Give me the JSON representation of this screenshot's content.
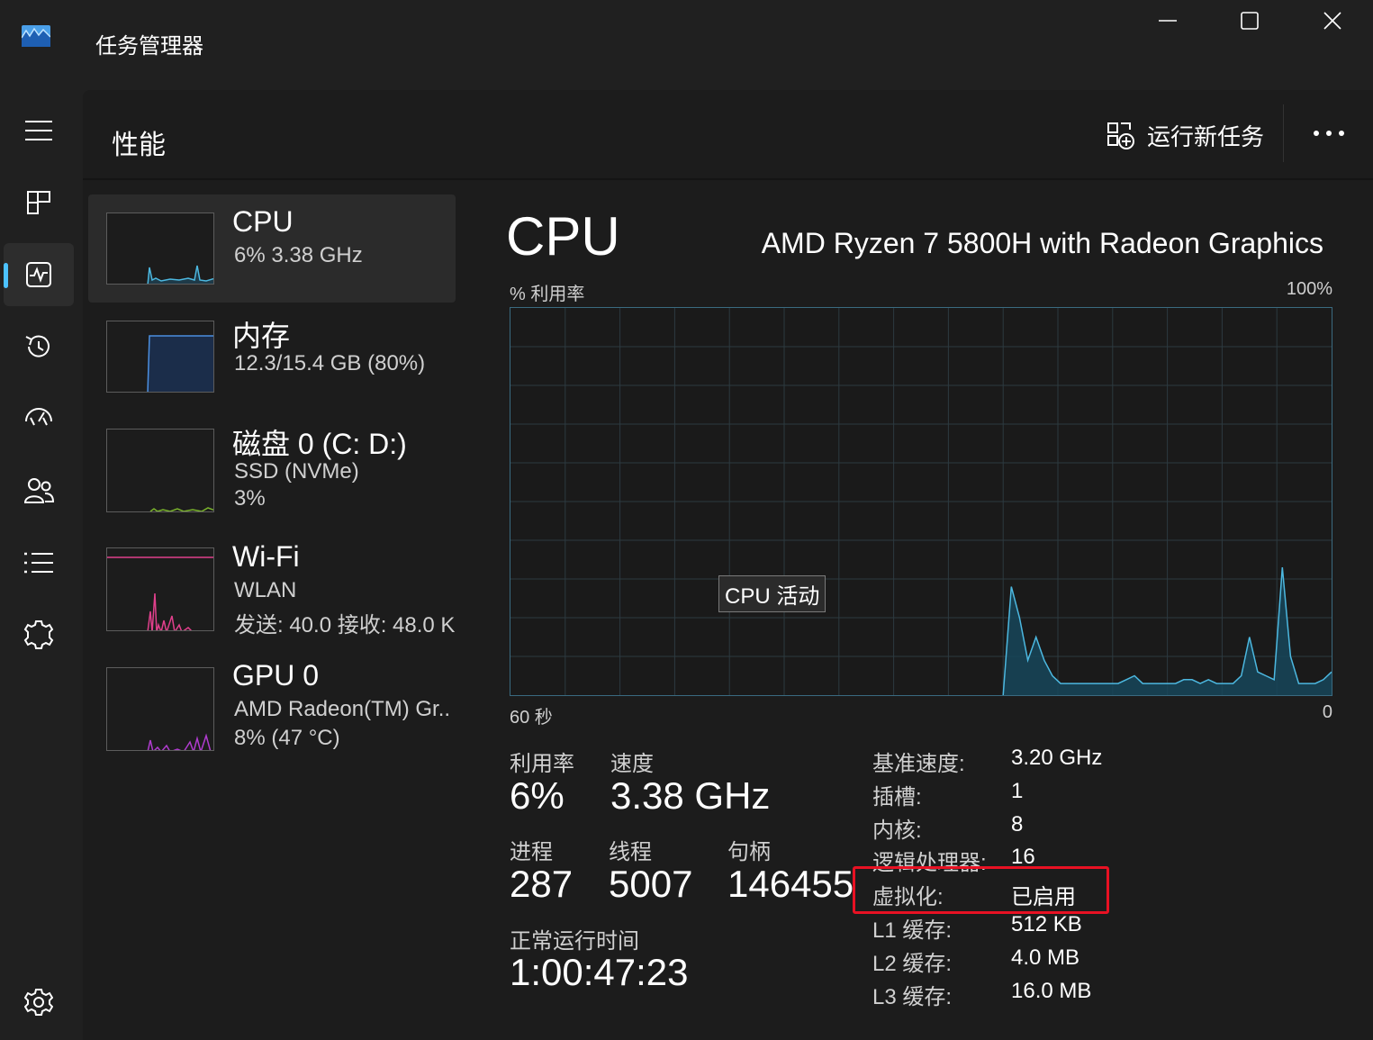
{
  "app": {
    "title": "任务管理器"
  },
  "nav": {
    "items": [
      {
        "name": "menu",
        "icon": "hamburger-icon"
      },
      {
        "name": "processes",
        "icon": "processes-icon"
      },
      {
        "name": "performance",
        "icon": "performance-icon",
        "active": true
      },
      {
        "name": "app-history",
        "icon": "history-icon"
      },
      {
        "name": "startup-apps",
        "icon": "startup-icon"
      },
      {
        "name": "users",
        "icon": "users-icon"
      },
      {
        "name": "details",
        "icon": "details-icon"
      },
      {
        "name": "services",
        "icon": "services-icon"
      },
      {
        "name": "settings",
        "icon": "settings-icon"
      }
    ]
  },
  "header": {
    "title": "性能",
    "run_task": "运行新任务"
  },
  "devices": [
    {
      "name": "CPU",
      "sub1": "6%  3.38 GHz",
      "color": "#4cb8e0",
      "selected": true
    },
    {
      "name": "内存",
      "sub1": "12.3/15.4 GB (80%)",
      "color": "#4b8fe0"
    },
    {
      "name": "磁盘 0 (C: D:)",
      "sub1": "SSD (NVMe)",
      "sub2": "3%",
      "color": "#7ab32c"
    },
    {
      "name": "Wi-Fi",
      "sub1": "WLAN",
      "sub2": "发送: 40.0 接收: 48.0 K",
      "color": "#e0408c"
    },
    {
      "name": "GPU 0",
      "sub1": "AMD Radeon(TM) Gr..",
      "sub2": "8% (47 °C)",
      "color": "#b03ccf"
    }
  ],
  "detail": {
    "title": "CPU",
    "model": "AMD Ryzen 7 5800H with Radeon Graphics",
    "y_label": "% 利用率",
    "y_max": "100%",
    "x_left": "60 秒",
    "x_right": "0",
    "tooltip": "CPU 活动",
    "stats": {
      "util_label": "利用率",
      "util_value": "6%",
      "speed_label": "速度",
      "speed_value": "3.38 GHz",
      "proc_label": "进程",
      "proc_value": "287",
      "thread_label": "线程",
      "thread_value": "5007",
      "handle_label": "句柄",
      "handle_value": "146455",
      "uptime_label": "正常运行时间",
      "uptime_value": "1:00:47:23"
    },
    "info": [
      {
        "key": "基准速度:",
        "value": "3.20 GHz"
      },
      {
        "key": "插槽:",
        "value": "1"
      },
      {
        "key": "内核:",
        "value": "8"
      },
      {
        "key": "逻辑处理器:",
        "value": "16"
      },
      {
        "key": "虚拟化:",
        "value": "已启用"
      },
      {
        "key": "L1 缓存:",
        "value": "512 KB"
      },
      {
        "key": "L2 缓存:",
        "value": "4.0 MB"
      },
      {
        "key": "L3 缓存:",
        "value": "16.0 MB"
      }
    ],
    "cpu_history_percent": [
      0,
      0,
      0,
      0,
      0,
      0,
      0,
      0,
      0,
      0,
      0,
      0,
      0,
      0,
      0,
      0,
      0,
      0,
      0,
      0,
      0,
      0,
      0,
      0,
      0,
      0,
      0,
      0,
      0,
      0,
      0,
      0,
      0,
      0,
      0,
      0,
      0,
      0,
      0,
      0,
      0,
      0,
      0,
      0,
      0,
      0,
      0,
      0,
      0,
      0,
      0,
      0,
      0,
      0,
      0,
      0,
      0,
      0,
      0,
      0,
      0,
      28,
      20,
      9,
      15,
      9,
      5,
      3,
      3,
      3,
      3,
      3,
      3,
      3,
      3,
      4,
      5,
      3,
      3,
      3,
      3,
      3,
      4,
      4,
      3,
      4,
      3,
      3,
      3,
      5,
      15,
      6,
      5,
      4,
      33,
      10,
      3,
      3,
      3,
      4,
      6
    ],
    "accent": "#4cb8e0",
    "highlight_color": "#e81123"
  }
}
